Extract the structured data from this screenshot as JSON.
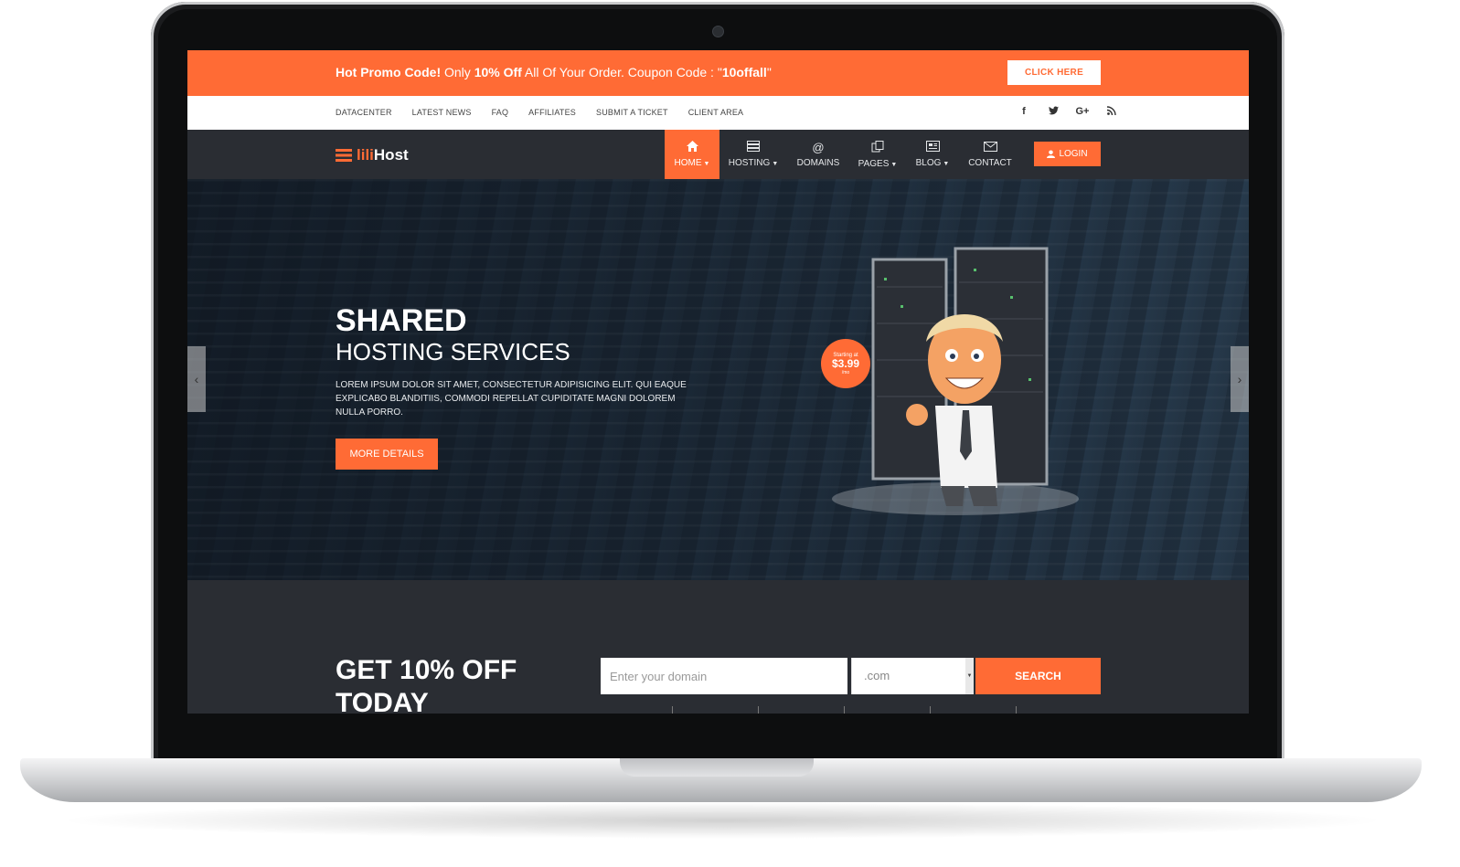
{
  "promo": {
    "bold_lead": "Hot Promo Code!",
    "text_1": " Only ",
    "bold_discount": "10% Off",
    "text_2": " All Of Your Order. Coupon Code : \"",
    "code": "10offall",
    "text_3": "\"",
    "button_label": "CLICK HERE"
  },
  "top_links": [
    "DATACENTER",
    "LATEST NEWS",
    "FAQ",
    "AFFILIATES",
    "SUBMIT A TICKET",
    "CLIENT AREA"
  ],
  "social": {
    "facebook": "f",
    "twitter": "t",
    "google_plus": "G+",
    "rss": "rss"
  },
  "brand": {
    "prefix": "lili",
    "name": "Host"
  },
  "nav": {
    "home": "HOME",
    "hosting": "HOSTING",
    "domains": "DOMAINS",
    "pages": "PAGES",
    "blog": "BLOG",
    "contact": "CONTACT",
    "login": "LOGIN"
  },
  "hero": {
    "title_1": "SHARED",
    "title_2": "HOSTING SERVICES",
    "description": "LOREM IPSUM DOLOR SIT AMET, CONSECTETUR ADIPISICING ELIT. QUI EAQUE EXPLICABO BLANDITIIS, COMMODI REPELLAT CUPIDITATE MAGNI DOLOREM NULLA PORRO.",
    "button_label": "MORE DETAILS",
    "price_badge": {
      "starting": "Starting at",
      "price": "$3.99",
      "period": "/mo"
    }
  },
  "domain_search": {
    "title": "GET 10% OFF TODAY",
    "input_placeholder": "Enter your domain",
    "tld_value": ".com",
    "button_label": "SEARCH"
  },
  "colors": {
    "accent": "#ff6b35",
    "dark": "#2a2d33"
  }
}
